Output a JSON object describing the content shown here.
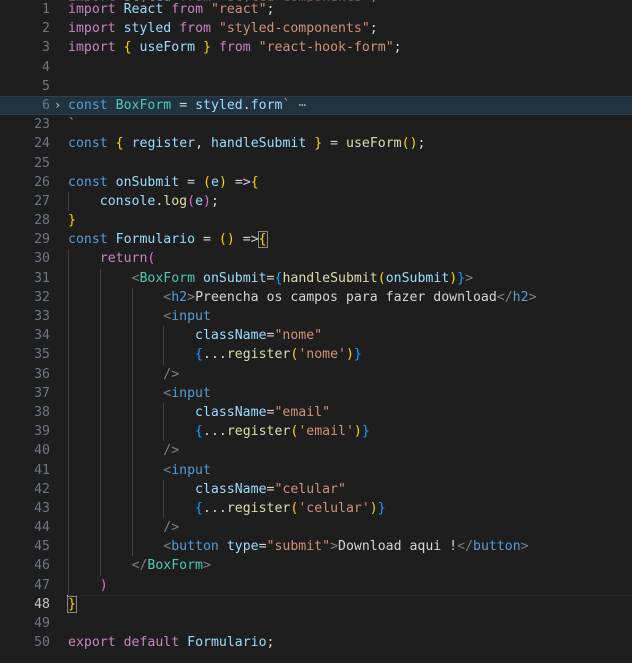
{
  "editor": {
    "theme": "VS Code Dark+",
    "language": "javascriptreact",
    "background": "#1e1e1e",
    "gutter_color": "#6e7681",
    "highlight_color": "#223340",
    "first_visible_line": 1,
    "last_visible_line": 50,
    "active_line": 48,
    "folded_line": 6,
    "fold_chevron": "›",
    "fold_ellipsis": "⋯",
    "partial_top_line_text": "import styled from \"styled-components\";"
  },
  "lines": [
    {
      "n": "1",
      "indent": 0,
      "text": "import React from \"react\";"
    },
    {
      "n": "2",
      "indent": 0,
      "text": "import styled from \"styled-components\";"
    },
    {
      "n": "3",
      "indent": 0,
      "text": "import { useForm } from \"react-hook-form\";"
    },
    {
      "n": "4",
      "indent": 0,
      "text": ""
    },
    {
      "n": "5",
      "indent": 0,
      "text": ""
    },
    {
      "n": "6",
      "indent": 0,
      "text": "const BoxForm = styled.form` ⋯"
    },
    {
      "n": "23",
      "indent": 0,
      "text": "`"
    },
    {
      "n": "24",
      "indent": 0,
      "text": "const { register, handleSubmit } = useForm();"
    },
    {
      "n": "25",
      "indent": 0,
      "text": ""
    },
    {
      "n": "26",
      "indent": 0,
      "text": "const onSubmit = (e) =>{"
    },
    {
      "n": "27",
      "indent": 1,
      "text": "console.log(e);"
    },
    {
      "n": "28",
      "indent": 0,
      "text": "}"
    },
    {
      "n": "29",
      "indent": 0,
      "text": "const Formulario = () =>{"
    },
    {
      "n": "30",
      "indent": 1,
      "text": "return("
    },
    {
      "n": "31",
      "indent": 2,
      "text": "<BoxForm onSubmit={handleSubmit(onSubmit)}>"
    },
    {
      "n": "32",
      "indent": 3,
      "text": "<h2>Preencha os campos para fazer download</h2>"
    },
    {
      "n": "33",
      "indent": 3,
      "text": "<input"
    },
    {
      "n": "34",
      "indent": 4,
      "text": "className=\"nome\""
    },
    {
      "n": "35",
      "indent": 4,
      "text": "{...register('nome')}"
    },
    {
      "n": "36",
      "indent": 3,
      "text": "/>"
    },
    {
      "n": "37",
      "indent": 3,
      "text": "<input"
    },
    {
      "n": "38",
      "indent": 4,
      "text": "className=\"email\""
    },
    {
      "n": "39",
      "indent": 4,
      "text": "{...register('email')}"
    },
    {
      "n": "40",
      "indent": 3,
      "text": "/>"
    },
    {
      "n": "41",
      "indent": 3,
      "text": "<input"
    },
    {
      "n": "42",
      "indent": 4,
      "text": "className=\"celular\""
    },
    {
      "n": "43",
      "indent": 4,
      "text": "{...register('celular')}"
    },
    {
      "n": "44",
      "indent": 3,
      "text": "/>"
    },
    {
      "n": "45",
      "indent": 3,
      "text": "<button type=\"submit\">Download aqui !</button>"
    },
    {
      "n": "46",
      "indent": 2,
      "text": "</BoxForm>"
    },
    {
      "n": "47",
      "indent": 1,
      "text": ")"
    },
    {
      "n": "48",
      "indent": 0,
      "text": "}"
    },
    {
      "n": "49",
      "indent": 0,
      "text": ""
    },
    {
      "n": "50",
      "indent": 0,
      "text": "export default Formulario;"
    }
  ],
  "tokens": {
    "keyword_control": "#c586c0",
    "keyword_decl": "#569cd6",
    "identifier": "#9cdcfe",
    "string": "#ce9178",
    "function": "#dcdcaa",
    "component": "#4ec9b0",
    "plain": "#d4d4d4",
    "bracket1": "#ffd700",
    "bracket2": "#da70d6",
    "bracket3": "#179fff"
  }
}
